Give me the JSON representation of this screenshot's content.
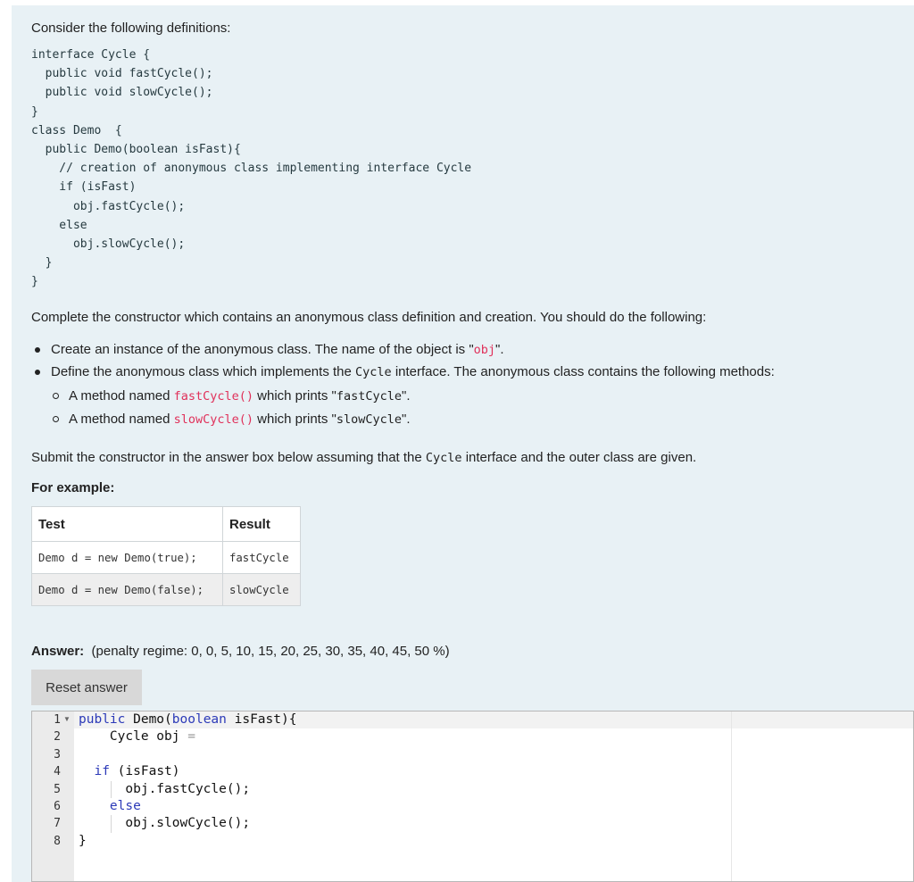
{
  "question": {
    "intro": "Consider the following definitions:",
    "code_lines": [
      "interface Cycle {",
      "  public void fastCycle();",
      "  public void slowCycle();",
      "}",
      "class Demo  {",
      "  public Demo(boolean isFast){",
      "    // creation of anonymous class implementing interface Cycle",
      "    if (isFast)",
      "      obj.fastCycle();",
      "    else",
      "      obj.slowCycle();",
      "  }",
      "}"
    ],
    "instructions": "Complete the constructor which contains an anonymous class definition and creation. You should do the following:",
    "bullet1": {
      "text_before": "Create an instance of the anonymous class. The name of the object is \"",
      "code": "obj",
      "text_after": "\"."
    },
    "bullet2": {
      "text_before": "Define the anonymous class which implements the ",
      "code": "Cycle",
      "text_after": " interface. The anonymous class contains the following methods:"
    },
    "sub1": {
      "text_before": "A method named ",
      "code": "fastCycle()",
      "text_mid": " which prints \"",
      "code2": "fastCycle",
      "text_after": "\"."
    },
    "sub2": {
      "text_before": "A method named ",
      "code": "slowCycle()",
      "text_mid": " which prints \"",
      "code2": "slowCycle",
      "text_after": "\"."
    },
    "submit": {
      "text_before": "Submit the constructor in the answer box below assuming that the ",
      "code": "Cycle",
      "text_after": " interface and the outer class are given."
    },
    "example_heading": "For example:",
    "table": {
      "headers": [
        "Test",
        "Result"
      ],
      "rows": [
        [
          "Demo d = new Demo(true);",
          "fastCycle"
        ],
        [
          "Demo d = new Demo(false);",
          "slowCycle"
        ]
      ]
    }
  },
  "answer": {
    "label": "Answer:",
    "penalty": "(penalty regime: 0, 0, 5, 10, 15, 20, 25, 30, 35, 40, 45, 50 %)",
    "reset_label": "Reset answer",
    "line_numbers": [
      "1",
      "2",
      "3",
      "4",
      "5",
      "6",
      "7",
      "8"
    ],
    "code": {
      "l1_kw": "public",
      "l1_a": " Demo(",
      "l1_kw2": "boolean",
      "l1_b": " isFast){",
      "l2_a": "    Cycle obj ",
      "l2_op": "=",
      "l4_a": "  ",
      "l4_kw": "if",
      "l4_b": " (isFast)",
      "l5": "      obj.fastCycle();",
      "l6_a": "    ",
      "l6_kw": "else",
      "l7": "      obj.slowCycle();",
      "l8": "}"
    }
  }
}
